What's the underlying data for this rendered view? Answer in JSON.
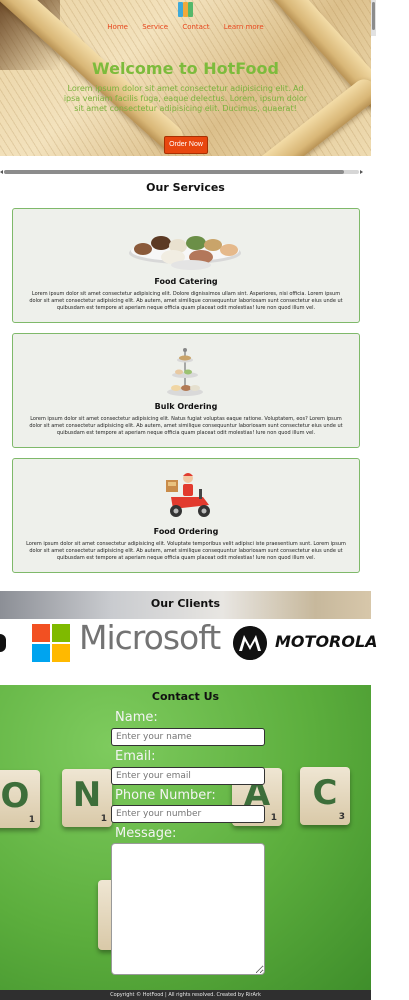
{
  "nav": {
    "items": [
      "Home",
      "Service",
      "Contact",
      "Learn more"
    ]
  },
  "hero": {
    "title": "Welcome to HotFood",
    "lede": "Lorem ipsum dolor sit amet consectetur adipisicing elit. Ad ipsa veniam facilis fuga, eaque delectus. Lorem, ipsum dolor sit amet consectetur adipisicing elit. Ducimus, quaerat!",
    "order_button": "Order Now"
  },
  "services": {
    "title": "Our Services",
    "cards": [
      {
        "image_icon": "food-platter-icon",
        "title": "Food Catering",
        "text": "Lorem ipsum dolor sit amet consectetur adipisicing elit. Dolore dignissimos ullam sint. Asperiores, nisi officia. Lorem ipsum dolor sit amet consectetur adipisicing elit. Ab autem, amet similique consequuntur laboriosam sunt consectetur eius unde ut quibusdam est tempore at aperiam neque officia quam placeat odit molestias! Iure non quod illum vel."
      },
      {
        "image_icon": "cake-stand-icon",
        "title": "Bulk Ordering",
        "text": "Lorem ipsum dolor sit amet consectetur adipisicing elit. Natus fugiat voluptas eaque ratione. Voluptatem, eos? Lorem ipsum dolor sit amet consectetur adipisicing elit. Ab autem, amet similique consequuntur laboriosam sunt consectetur eius unde ut quibusdam est tempore at aperiam neque officia quam placeat odit molestias! Iure non quod illum vel."
      },
      {
        "image_icon": "delivery-scooter-icon",
        "title": "Food Ordering",
        "text": "Lorem ipsum dolor sit amet consectetur adipisicing elit. Voluptate temporibus velit adipisci iste praesentium sunt. Lorem ipsum dolor sit amet consectetur adipisicing elit. Ab autem, amet similique consequuntur laboriosam sunt consectetur eius unde ut quibusdam est tempore at aperiam neque officia quam placeat odit molestias! Iure non quod illum vel."
      }
    ]
  },
  "clients": {
    "title": "Our Clients",
    "logos": [
      "Microsoft",
      "MOTOROLA"
    ]
  },
  "contact": {
    "title": "Contact Us",
    "background_tiles": [
      "O",
      "N",
      "A",
      "C"
    ],
    "tile_numbers": [
      "1",
      "1",
      "1",
      "3"
    ],
    "name_label": "Name:",
    "name_placeholder": "Enter your name",
    "email_label": "Email:",
    "email_placeholder": "Enter your email",
    "phone_label": "Phone Number:",
    "phone_placeholder": "Enter your number",
    "message_label": "Message:"
  },
  "footer": {
    "text": "Copyright © HotFood | All rights resolved. Created by RirArk"
  },
  "colors": {
    "accent": "#e8470f",
    "hero_title": "#7dbb3c",
    "card_border": "#7fb96a",
    "contact_bg": "#5cae3d"
  }
}
